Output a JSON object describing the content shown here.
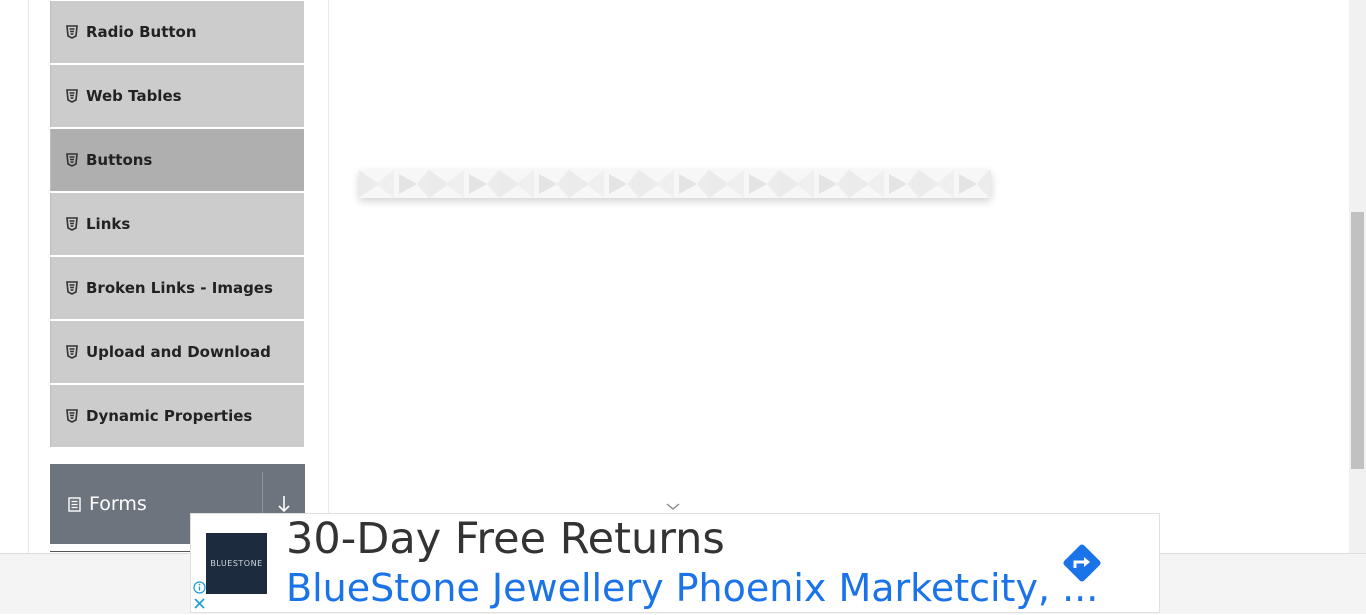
{
  "sidebar": {
    "items": [
      {
        "label": "Radio Button",
        "icon": "html5-icon",
        "active": false
      },
      {
        "label": "Web Tables",
        "icon": "html5-icon",
        "active": false
      },
      {
        "label": "Buttons",
        "icon": "html5-icon",
        "active": true
      },
      {
        "label": "Links",
        "icon": "html5-icon",
        "active": false
      },
      {
        "label": "Broken Links - Images",
        "icon": "html5-icon",
        "active": false
      },
      {
        "label": "Upload and Download",
        "icon": "html5-icon",
        "active": false
      },
      {
        "label": "Dynamic Properties",
        "icon": "html5-icon",
        "active": false
      }
    ],
    "group": {
      "label": "Forms",
      "icon": "document-icon",
      "toggle_icon": "arrow-down-icon"
    }
  },
  "ad": {
    "logo_text": "BLUESTONE",
    "title": "30-Day Free Returns",
    "subtitle": "BlueStone Jewellery Phoenix Marketcity, ...",
    "direction_icon": "directions-icon",
    "info_icon": "info-icon",
    "close_icon": "close-icon"
  },
  "colors": {
    "menu_bg": "#cccccc",
    "menu_active_bg": "#afafaf",
    "group_bg": "#6c757d",
    "ad_link": "#1a73e8"
  }
}
